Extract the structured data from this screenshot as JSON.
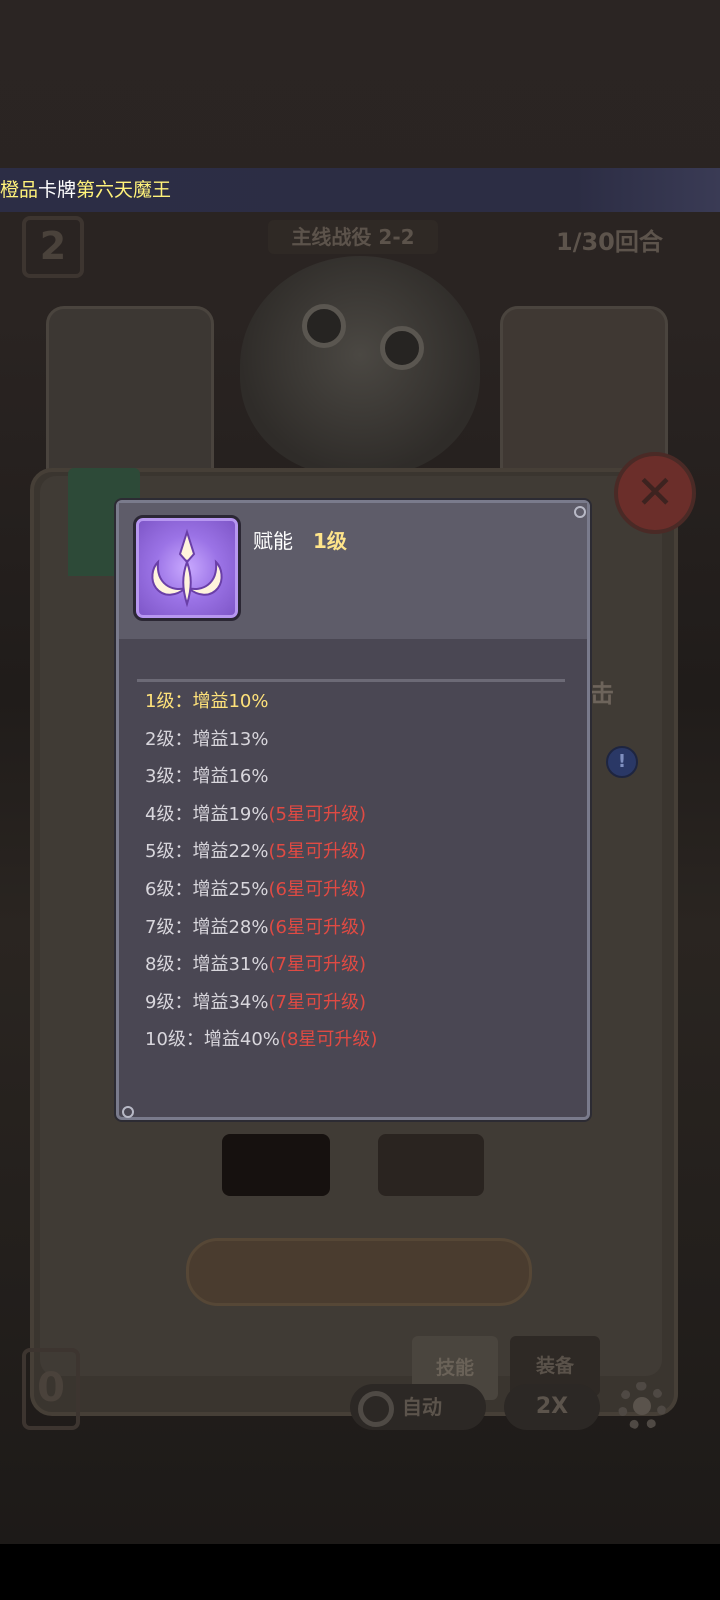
{
  "banner": {
    "quality": "橙品",
    "card_label": "卡牌",
    "card_name": "第六天魔王"
  },
  "hud": {
    "wave_number": "2",
    "stage_title": "主线战役 2-2",
    "round": "1/30回合",
    "bottom_number": "0",
    "close_symbol": "✕",
    "info_symbol": "!",
    "side_char": "击",
    "tab_skill": "技能",
    "tab_equip": "装备",
    "auto": "自动",
    "speed": "2X"
  },
  "popup": {
    "skill_name": "赋能",
    "skill_level": "1级",
    "levels": [
      {
        "label": "1级：增益10%",
        "req": ""
      },
      {
        "label": "2级：增益13%",
        "req": ""
      },
      {
        "label": "3级：增益16%",
        "req": ""
      },
      {
        "label": "4级：增益19%",
        "req": "(5星可升级)"
      },
      {
        "label": "5级：增益22%",
        "req": "(5星可升级)"
      },
      {
        "label": "6级：增益25%",
        "req": "(6星可升级)"
      },
      {
        "label": "7级：增益28%",
        "req": "(6星可升级)"
      },
      {
        "label": "8级：增益31%",
        "req": "(7星可升级)"
      },
      {
        "label": "9级：增益34%",
        "req": "(7星可升级)"
      },
      {
        "label": "10级：增益40%",
        "req": "(8星可升级)"
      }
    ]
  },
  "colors": {
    "highlight": "#ffe27a",
    "requirement": "#e04a43",
    "banner_bg": "#2c2d45"
  }
}
